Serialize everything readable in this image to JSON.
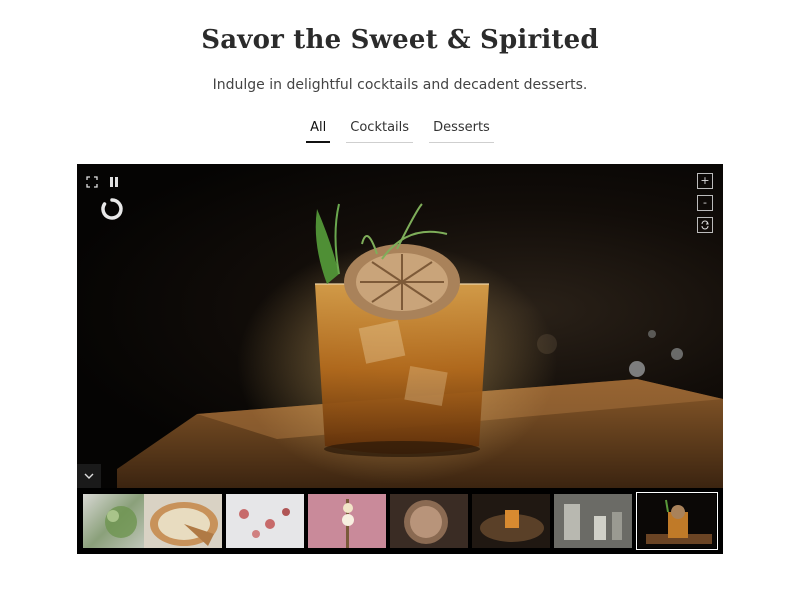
{
  "header": {
    "title": "Savor the Sweet & Spirited",
    "subtitle": "Indulge in delightful cocktails and decadent desserts."
  },
  "tabs": [
    {
      "label": "All",
      "active": true
    },
    {
      "label": "Cocktails",
      "active": false
    },
    {
      "label": "Desserts",
      "active": false
    }
  ],
  "viewer": {
    "controls": {
      "fullscreen_icon": "fullscreen-icon",
      "pause_icon": "pause-icon",
      "loading_icon": "loading-spinner-icon",
      "zoom_in_label": "+",
      "zoom_out_label": "-",
      "rotate_icon": "rotate-icon",
      "collapse_icon": "chevron-down-icon"
    },
    "thumbnails": [
      {
        "subject": "herb salad",
        "active": false
      },
      {
        "subject": "pie",
        "active": false
      },
      {
        "subject": "desserts on table",
        "active": false
      },
      {
        "subject": "skewer on pink",
        "active": false
      },
      {
        "subject": "tart",
        "active": false
      },
      {
        "subject": "cocktail on tray",
        "active": false
      },
      {
        "subject": "bar setup",
        "active": false
      },
      {
        "subject": "cocktail dark",
        "active": true
      }
    ]
  },
  "colors": {
    "tab_active_underline": "#111111",
    "viewer_bg": "#000000"
  }
}
